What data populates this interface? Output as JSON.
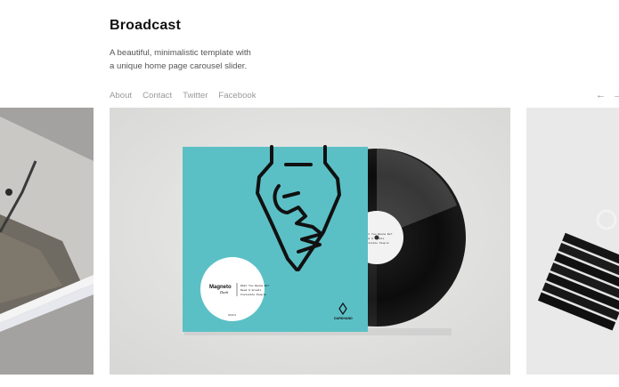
{
  "header": {
    "title": "Broadcast",
    "tagline": "A beautiful, minimalistic template with a unique home page carousel slider."
  },
  "nav": {
    "items": [
      "About",
      "Contact",
      "Twitter",
      "Facebook"
    ]
  },
  "carousel": {
    "prev_icon": "arrow-left-icon",
    "next_icon": "arrow-right-icon",
    "prev_glyph": "←",
    "next_glyph": "→"
  },
  "record_sleeve": {
    "label_brand": "Magneto",
    "label_sub": "Dark",
    "tracklist": [
      "What You Wanna Be?",
      "Need U Greats",
      "Invisible People"
    ],
    "catalog": "MAG001",
    "logo_text": "DARKHAND"
  },
  "colors": {
    "accent_teal": "#5bc0c6",
    "vinyl": "#111111",
    "nav_text": "#999999"
  }
}
